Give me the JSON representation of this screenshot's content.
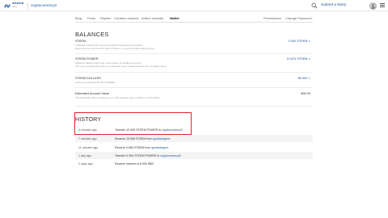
{
  "header": {
    "brand": "steemit",
    "brand_sub": "beta",
    "username": "cryptocurrency3",
    "submit_label": "Submit a Story",
    "icons": {
      "logo": "steemit-logo-icon",
      "search": "search-icon",
      "avatar": "user-avatar",
      "menu": "hamburger-menu-icon"
    }
  },
  "nav": {
    "tabs": [
      "Blog",
      "Posts",
      "Replies",
      "Curation rewards",
      "Author rewards",
      "Wallet"
    ],
    "active_tab": "Wallet",
    "right_tabs": [
      "Permissions",
      "Change Password"
    ]
  },
  "balances": {
    "title": "BALANCES",
    "items": [
      {
        "name": "STEEM",
        "desc": [
          "Tradeable tokens that may be transferred anywhere at anytime.",
          "Steem can be converted to Steem Power in a process called powering up."
        ],
        "value": "0.000 STEEM",
        "has_caret": true
      },
      {
        "name": "STEEM POWER",
        "desc": [
          "Influence tokens which earn more power by holding long term.",
          "The more you hold the more you influence post rewards and earn for accurate voting."
        ],
        "value": "10.874 STEEM",
        "has_caret": true
      },
      {
        "name": "STEEM DOLLARS",
        "desc": [
          "Tokens worth about $1.00 of STEEM."
        ],
        "value": "$0.000",
        "has_caret": true
      },
      {
        "name": "Estimated Account Value",
        "desc": [
          "The estimated value is based on a 7 day average value of Steem in US dollars."
        ],
        "value": "$95.29",
        "has_caret": false
      }
    ]
  },
  "history": {
    "title": "HISTORY",
    "rows": [
      {
        "time": "4 minutes ago",
        "text": "Transfer 10.505 STEEM POWER to ",
        "link": "cryptocurrency3"
      },
      {
        "time": "7 minutes ago",
        "text": "Receive 10.505 STEEM from ",
        "link": "sportsdegree"
      },
      {
        "time": "11 minutes ago",
        "text": "Receive 0.969 STEEM from ",
        "link": "sportsdegree"
      },
      {
        "time": "1 day ago",
        "text": "Transfer 0.390 STEEM POWER to ",
        "link": "cryptocurrency3"
      },
      {
        "time": "2 days ago",
        "text": "Receive interest of 0.000 SBD",
        "link": ""
      }
    ]
  },
  "colors": {
    "link": "#1a5099",
    "highlight_border": "#e0262c",
    "row_shade": "#f4f4f4"
  }
}
